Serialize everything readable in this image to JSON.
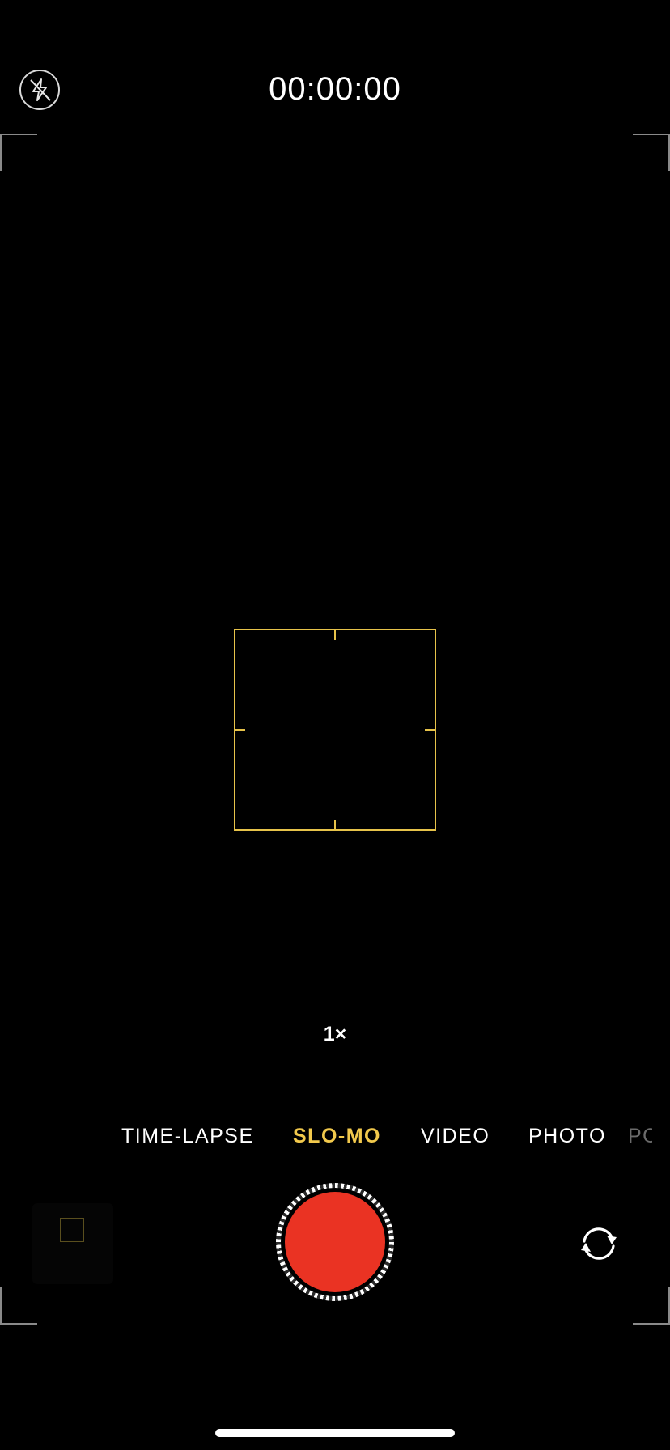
{
  "top_bar": {
    "flash_icon": "flash-off-icon",
    "timer": "00:00:00"
  },
  "viewfinder": {
    "focus_color": "#e6c24a",
    "zoom_label": "1×"
  },
  "modes": {
    "items": [
      {
        "label": "TIME-LAPSE",
        "active": false
      },
      {
        "label": "SLO-MO",
        "active": true
      },
      {
        "label": "VIDEO",
        "active": false
      },
      {
        "label": "PHOTO",
        "active": false
      },
      {
        "label": "POR",
        "active": false
      }
    ],
    "active_color": "#f2c94c"
  },
  "controls": {
    "thumbnail_icon": "last-capture-thumbnail",
    "shutter_icon": "record-button",
    "shutter_color": "#ea3323",
    "flip_icon": "camera-flip-icon"
  }
}
